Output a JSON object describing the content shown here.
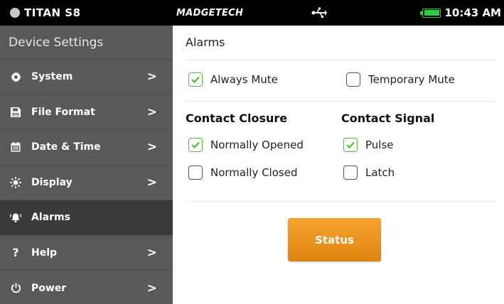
{
  "status_bar": {
    "device": "TITAN S8",
    "brand": "MADGETECH",
    "time": "10:43 AM",
    "battery_level": 1.0,
    "usb_icon": "usb-icon",
    "accent": "#2ecc40"
  },
  "sidebar": {
    "header": "Device Settings",
    "items": [
      {
        "label": "System",
        "icon": "gear-icon",
        "chevron": ">"
      },
      {
        "label": "File Format",
        "icon": "floppy-icon",
        "chevron": ">"
      },
      {
        "label": "Date & Time",
        "icon": "calendar-icon",
        "chevron": ">"
      },
      {
        "label": "Display",
        "icon": "sun-icon",
        "chevron": ">"
      },
      {
        "label": "Alarms",
        "icon": "bell-icon",
        "active": true
      },
      {
        "label": "Help",
        "icon": "question-icon",
        "chevron": ">"
      },
      {
        "label": "Power",
        "icon": "power-icon",
        "chevron": ">"
      }
    ]
  },
  "main": {
    "title": "Alarms",
    "always_mute": {
      "label": "Always Mute",
      "checked": true
    },
    "temporary_mute": {
      "label": "Temporary Mute",
      "checked": false
    },
    "contact_closure": {
      "heading": "Contact Closure",
      "normally_opened": {
        "label": "Normally Opened",
        "checked": true
      },
      "normally_closed": {
        "label": "Normally Closed",
        "checked": false
      }
    },
    "contact_signal": {
      "heading": "Contact Signal",
      "pulse": {
        "label": "Pulse",
        "checked": true
      },
      "latch": {
        "label": "Latch",
        "checked": false
      }
    },
    "status_button": "Status"
  },
  "colors": {
    "sidebar_bg": "#595959",
    "sidebar_active": "#3a3a3a",
    "checkbox_checked": "#55b93b",
    "button_orange": "#ef9a20"
  }
}
